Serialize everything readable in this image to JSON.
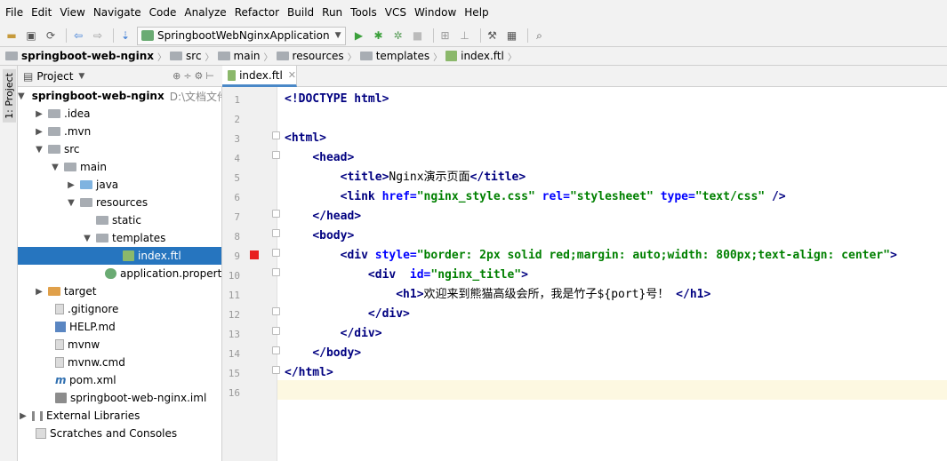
{
  "menu": [
    "File",
    "Edit",
    "View",
    "Navigate",
    "Code",
    "Analyze",
    "Refactor",
    "Build",
    "Run",
    "Tools",
    "VCS",
    "Window",
    "Help"
  ],
  "toolbar": {
    "run_config": "SpringbootWebNginxApplication"
  },
  "breadcrumb": [
    "springboot-web-nginx",
    "src",
    "main",
    "resources",
    "templates",
    "index.ftl"
  ],
  "left_strip": {
    "label": "1: Project"
  },
  "project_panel": {
    "title": "Project"
  },
  "tree": {
    "root": {
      "label": "springboot-web-nginx",
      "path": "D:\\文档文件"
    },
    "items": [
      ".idea",
      ".mvn",
      "src",
      "main",
      "java",
      "resources",
      "static",
      "templates",
      "index.ftl",
      "application.properties",
      "target",
      ".gitignore",
      "HELP.md",
      "mvnw",
      "mvnw.cmd",
      "pom.xml",
      "springboot-web-nginx.iml",
      "External Libraries",
      "Scratches and Consoles"
    ]
  },
  "editor": {
    "tab": "index.ftl",
    "line_numbers": [
      "1",
      "2",
      "3",
      "4",
      "5",
      "6",
      "7",
      "8",
      "9",
      "10",
      "11",
      "12",
      "13",
      "14",
      "15",
      "16"
    ],
    "code": {
      "l1": "<!DOCTYPE html>",
      "l5_text": "Nginx演示页面",
      "l6_href": "\"nginx_style.css\"",
      "l6_rel": "\"stylesheet\"",
      "l6_type": "\"text/css\"",
      "l9_style": "\"border: 2px solid red;margin: auto;width: 800px;text-align: center\"",
      "l10_id": "\"nginx_title\"",
      "l11_text": "欢迎来到熊猫高级会所，我是竹子${port}号！"
    }
  },
  "colors": {
    "selection": "#2675bf",
    "tag": "#000080",
    "attr_value": "#008000",
    "breakpoint": "#e82020",
    "current_line": "#fdf8e1"
  }
}
